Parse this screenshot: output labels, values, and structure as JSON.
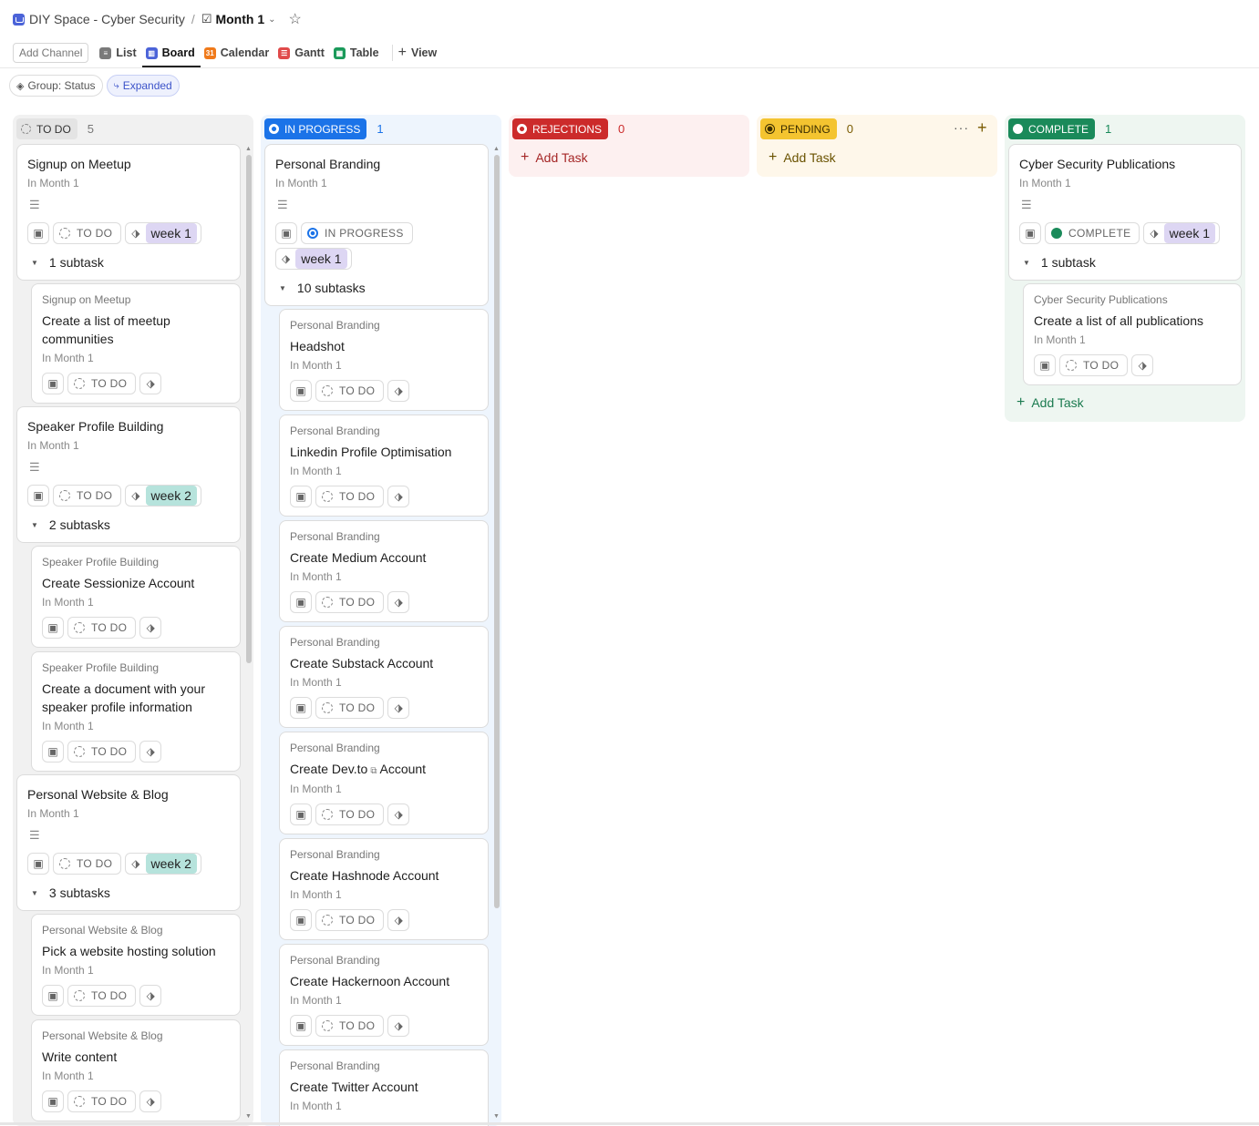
{
  "breadcrumb": {
    "space": "DIY Space - Cyber Security",
    "separator": "/",
    "list": "Month 1"
  },
  "viewbar": {
    "add_channel": "Add Channel",
    "tabs": [
      {
        "label": "List",
        "icon": "list-icon",
        "color": "#7a7a7a"
      },
      {
        "label": "Board",
        "icon": "board-icon",
        "color": "#4b63d8",
        "active": true
      },
      {
        "label": "Calendar",
        "icon": "calendar-icon",
        "color": "#f07a1a"
      },
      {
        "label": "Gantt",
        "icon": "gantt-icon",
        "color": "#e04a4a"
      },
      {
        "label": "Table",
        "icon": "table-icon",
        "color": "#1a9a5a"
      }
    ],
    "add_view": "View"
  },
  "filters": {
    "group": "Group: Status",
    "expanded": "Expanded"
  },
  "columns": {
    "todo": {
      "label": "TO DO",
      "count": "5"
    },
    "inprogress": {
      "label": "IN PROGRESS",
      "count": "1"
    },
    "rejections": {
      "label": "REJECTIONS",
      "count": "0",
      "add": "Add Task"
    },
    "pending": {
      "label": "PENDING",
      "count": "0",
      "add": "Add Task"
    },
    "complete": {
      "label": "COMPLETE",
      "count": "1",
      "add": "Add Task"
    }
  },
  "common": {
    "in_month": "In Month 1",
    "todo": "TO DO",
    "in_progress": "IN PROGRESS",
    "complete": "COMPLETE"
  },
  "cards": {
    "meetup": {
      "title": "Signup on Meetup",
      "tag": "week 1",
      "subtasks": "1 subtask",
      "subs": [
        {
          "parent": "Signup on Meetup",
          "title": "Create a list of meetup communities"
        }
      ]
    },
    "speaker": {
      "title": "Speaker Profile Building",
      "tag": "week 2",
      "subtasks": "2 subtasks",
      "subs": [
        {
          "parent": "Speaker Profile Building",
          "title": "Create Sessionize Account"
        },
        {
          "parent": "Speaker Profile Building",
          "title": "Create a document with your speaker profile information"
        }
      ]
    },
    "website": {
      "title": "Personal Website & Blog",
      "tag": "week 2",
      "subtasks": "3 subtasks",
      "subs": [
        {
          "parent": "Personal Website & Blog",
          "title": "Pick a website hosting solution"
        },
        {
          "parent": "Personal Website & Blog",
          "title": "Write content"
        }
      ]
    },
    "branding": {
      "title": "Personal Branding",
      "tag": "week 1",
      "subtasks": "10 subtasks",
      "subs": [
        {
          "parent": "Personal Branding",
          "title": "Headshot"
        },
        {
          "parent": "Personal Branding",
          "title": "Linkedin Profile Optimisation"
        },
        {
          "parent": "Personal Branding",
          "title": "Create Medium Account"
        },
        {
          "parent": "Personal Branding",
          "title": "Create Substack Account"
        },
        {
          "parent": "Personal Branding",
          "title_a": "Create Dev.to",
          "title_b": "Account"
        },
        {
          "parent": "Personal Branding",
          "title": "Create Hashnode Account"
        },
        {
          "parent": "Personal Branding",
          "title": "Create Hackernoon Account"
        },
        {
          "parent": "Personal Branding",
          "title": "Create Twitter Account"
        }
      ]
    },
    "publications": {
      "title": "Cyber Security Publications",
      "tag": "week 1",
      "subtasks": "1 subtask",
      "subs": [
        {
          "parent": "Cyber Security Publications",
          "title": "Create a list of all publications"
        }
      ]
    }
  },
  "colors": {
    "todo": "#e8e8e8",
    "inprogress": "#1b73e8",
    "rejections": "#cc2b2b",
    "pending": "#f4c430",
    "complete": "#1a8a5a",
    "week1": "#ddd6f3",
    "week2": "#b6e3dc"
  }
}
